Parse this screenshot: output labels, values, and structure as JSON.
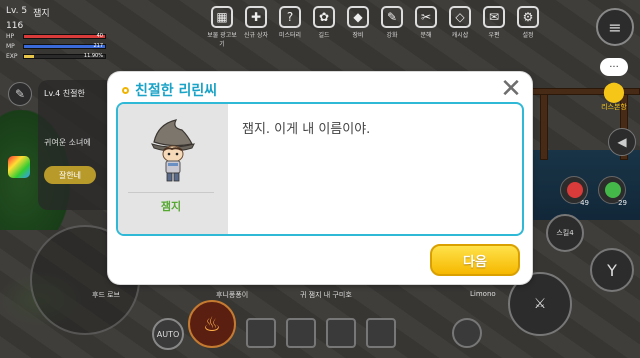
{
  "player": {
    "level": "Lv. 5",
    "name": "잼지",
    "power": "116",
    "stats": [
      {
        "label": "HP",
        "value": "40",
        "pct": 1.0,
        "color": "#d93a3a"
      },
      {
        "label": "MP",
        "value": "217",
        "pct": 1.0,
        "color": "#3a6ad9"
      },
      {
        "label": "EXP",
        "value": "11.90%",
        "pct": 0.119,
        "color": "#e7c64a"
      }
    ]
  },
  "top_menu": [
    {
      "label": "보물 광고보기",
      "icon": "▦"
    },
    {
      "label": "신규 상자",
      "icon": "✚"
    },
    {
      "label": "미스터리",
      "icon": "?"
    },
    {
      "label": "길드",
      "icon": "✿"
    },
    {
      "label": "장비",
      "icon": "◆"
    },
    {
      "label": "강화",
      "icon": "✎"
    },
    {
      "label": "분해",
      "icon": "✂"
    },
    {
      "label": "캐시샵",
      "icon": "◇"
    },
    {
      "label": "우편",
      "icon": "✉"
    },
    {
      "label": "설정",
      "icon": "⚙"
    }
  ],
  "quest": {
    "level": "Lv.4 친절한",
    "desc": "귀여운 소녀에",
    "button": "잘한네"
  },
  "right": {
    "map_label": "리스본항",
    "potions": [
      {
        "count": "49",
        "color": "#d93a3a"
      },
      {
        "count": "29",
        "color": "#45b84a"
      }
    ],
    "skill4_label": "스킬4"
  },
  "bottom": {
    "labels": [
      "후드 로브",
      "후니퐁퐁이",
      "귀 잼지 내 구미호",
      "Limono"
    ],
    "auto": "AUTO"
  },
  "dialog": {
    "title": "친절한 리린씨",
    "npc_name": "잼지",
    "text": "잼지. 이게 내 이름이야.",
    "next_button": "다음",
    "close_icon": "close-icon"
  }
}
